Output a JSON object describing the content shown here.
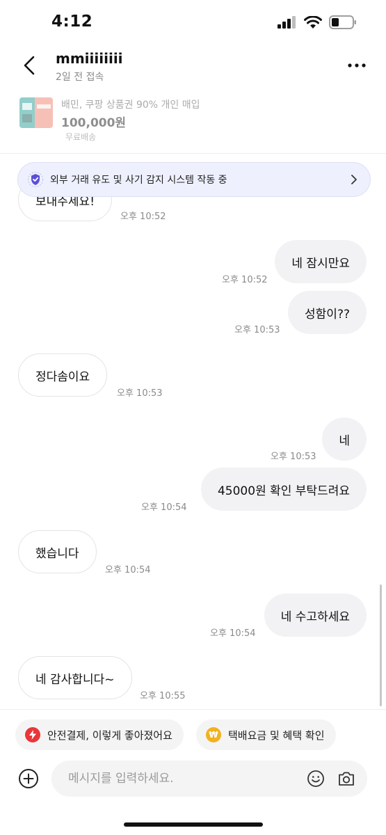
{
  "status_bar": {
    "time": "4:12"
  },
  "header": {
    "user_name": "mmiiiiiiii",
    "user_status": "2일 전 접속"
  },
  "product": {
    "title": "배민, 쿠팡 상품권 90% 개인 매입",
    "price": "100,000원",
    "shipping": "무료배송"
  },
  "safety_banner": {
    "text": "외부 거래 유도 및 사기 감지 시스템 작동 중"
  },
  "messages": [
    {
      "side": "in",
      "text": "보내주세요!",
      "time": ""
    },
    {
      "side": "in",
      "text": "",
      "time": "오후 10:52"
    },
    {
      "side": "out",
      "text": "네 잠시만요",
      "time": "오후 10:52"
    },
    {
      "side": "out",
      "text": "성함이??",
      "time": "오후 10:53"
    },
    {
      "side": "in",
      "text": "정다솜이요",
      "time": "오후 10:53"
    },
    {
      "side": "out",
      "text": "네",
      "time": "오후 10:53"
    },
    {
      "side": "out",
      "text": "45000원 확인 부탁드려요",
      "time": "오후 10:54"
    },
    {
      "side": "in",
      "text": "했습니다",
      "time": "오후 10:54"
    },
    {
      "side": "out",
      "text": "네 수고하세요",
      "time": "오후 10:54"
    },
    {
      "side": "in",
      "text": "네 감사합니다~",
      "time": "오후 10:55"
    }
  ],
  "chips": [
    {
      "label": "안전결제, 이렇게 좋아졌어요",
      "icon": "lightning-icon",
      "color": "#e8363a"
    },
    {
      "label": "택배요금 및 혜택 확인",
      "icon": "won-coin-icon",
      "color": "#f2b21f"
    }
  ],
  "composer": {
    "placeholder": "메시지를 입력하세요."
  }
}
